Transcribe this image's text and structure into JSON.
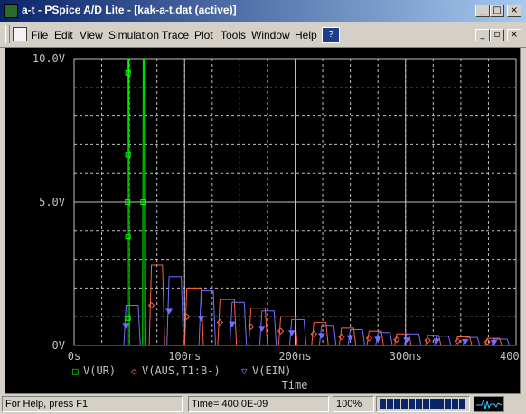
{
  "window": {
    "title": "a-t - PSpice A/D Lite - [kak-a-t.dat (active)]",
    "minimize": "_",
    "maximize": "□",
    "close": "×",
    "doc_minimize": "_",
    "doc_restore": "▫",
    "doc_close": "×"
  },
  "menu": {
    "items": [
      "File",
      "Edit",
      "View",
      "Simulation",
      "Trace",
      "Plot",
      "Tools",
      "Window",
      "Help"
    ]
  },
  "plot": {
    "y_ticks": [
      "10.0V",
      "5.0V",
      "0V"
    ],
    "x_ticks": [
      "0s",
      "100ns",
      "200ns",
      "300ns",
      "400ns"
    ],
    "x_axis_label": "Time",
    "legend": [
      {
        "symbol": "□",
        "label": "V(UR)",
        "color": "#00ff00"
      },
      {
        "symbol": "◇",
        "label": "V(AUS,T1:B-)",
        "color": "#ff6040"
      },
      {
        "symbol": "▽",
        "label": "V(EIN)",
        "color": "#7070ff"
      }
    ]
  },
  "status": {
    "help": "For Help, press F1",
    "time": "Time= 400.0E-09",
    "percent": "100%",
    "progress": 1.0
  },
  "colors": {
    "grid": "#c0c0c0",
    "ur": "#00ff00",
    "aus": "#ff6040",
    "ein": "#7070ff",
    "axis_text": "#c0c0c0"
  },
  "chart_data": {
    "type": "line",
    "xlabel": "Time",
    "x_unit": "ns",
    "xlim": [
      0,
      400
    ],
    "ylim": [
      0,
      10
    ],
    "x_ticks": [
      "0s",
      "100ns",
      "200ns",
      "300ns",
      "400ns"
    ],
    "y_ticks": [
      "0V",
      "5.0V",
      "10.0V"
    ],
    "series": [
      {
        "name": "V(UR)",
        "points": [
          [
            0,
            0
          ],
          [
            48,
            0
          ],
          [
            48.5,
            10
          ],
          [
            49.5,
            10
          ],
          [
            50,
            0
          ],
          [
            62,
            0
          ],
          [
            62.5,
            10
          ],
          [
            63.5,
            10
          ],
          [
            64,
            0
          ],
          [
            400,
            0
          ]
        ]
      },
      {
        "name": "V(AUS,T1:B-)",
        "points": [
          [
            0,
            0
          ],
          [
            68,
            0
          ],
          [
            70,
            2.8
          ],
          [
            80,
            2.8
          ],
          [
            82,
            0
          ],
          [
            100,
            0
          ],
          [
            102,
            2.0
          ],
          [
            115,
            2.0
          ],
          [
            117,
            0
          ],
          [
            130,
            0
          ],
          [
            132,
            1.6
          ],
          [
            145,
            1.6
          ],
          [
            147,
            0
          ],
          [
            158,
            0
          ],
          [
            160,
            1.3
          ],
          [
            173,
            1.3
          ],
          [
            175,
            0
          ],
          [
            185,
            0
          ],
          [
            187,
            1.0
          ],
          [
            200,
            1.0
          ],
          [
            202,
            0
          ],
          [
            215,
            0
          ],
          [
            217,
            0.8
          ],
          [
            228,
            0.8
          ],
          [
            230,
            0
          ],
          [
            240,
            0
          ],
          [
            242,
            0.6
          ],
          [
            253,
            0.6
          ],
          [
            255,
            0
          ],
          [
            265,
            0
          ],
          [
            267,
            0.5
          ],
          [
            278,
            0.5
          ],
          [
            280,
            0
          ],
          [
            290,
            0
          ],
          [
            292,
            0.4
          ],
          [
            303,
            0.4
          ],
          [
            305,
            0
          ],
          [
            318,
            0
          ],
          [
            320,
            0.35
          ],
          [
            330,
            0.35
          ],
          [
            332,
            0
          ],
          [
            345,
            0
          ],
          [
            347,
            0.3
          ],
          [
            358,
            0.3
          ],
          [
            360,
            0
          ],
          [
            372,
            0
          ],
          [
            374,
            0.25
          ],
          [
            385,
            0.25
          ],
          [
            387,
            0
          ],
          [
            400,
            0
          ]
        ]
      },
      {
        "name": "V(EIN)",
        "points": [
          [
            0,
            0
          ],
          [
            45,
            0
          ],
          [
            47,
            1.4
          ],
          [
            58,
            1.4
          ],
          [
            60,
            0
          ],
          [
            84,
            0
          ],
          [
            86,
            2.4
          ],
          [
            97,
            2.4
          ],
          [
            99,
            0
          ],
          [
            113,
            0
          ],
          [
            115,
            1.9
          ],
          [
            126,
            1.9
          ],
          [
            128,
            0
          ],
          [
            141,
            0
          ],
          [
            143,
            1.5
          ],
          [
            154,
            1.5
          ],
          [
            156,
            0
          ],
          [
            168,
            0
          ],
          [
            170,
            1.2
          ],
          [
            181,
            1.2
          ],
          [
            183,
            0
          ],
          [
            195,
            0
          ],
          [
            197,
            0.9
          ],
          [
            208,
            0.9
          ],
          [
            210,
            0
          ],
          [
            222,
            0
          ],
          [
            224,
            0.7
          ],
          [
            235,
            0.7
          ],
          [
            237,
            0
          ],
          [
            248,
            0
          ],
          [
            250,
            0.55
          ],
          [
            261,
            0.55
          ],
          [
            263,
            0
          ],
          [
            273,
            0
          ],
          [
            275,
            0.45
          ],
          [
            286,
            0.45
          ],
          [
            288,
            0
          ],
          [
            299,
            0
          ],
          [
            301,
            0.4
          ],
          [
            312,
            0.4
          ],
          [
            314,
            0
          ],
          [
            326,
            0
          ],
          [
            328,
            0.32
          ],
          [
            339,
            0.32
          ],
          [
            341,
            0
          ],
          [
            352,
            0
          ],
          [
            354,
            0.28
          ],
          [
            365,
            0.28
          ],
          [
            367,
            0
          ],
          [
            378,
            0
          ],
          [
            380,
            0.22
          ],
          [
            392,
            0.22
          ],
          [
            394,
            0
          ],
          [
            400,
            0
          ]
        ]
      }
    ]
  }
}
